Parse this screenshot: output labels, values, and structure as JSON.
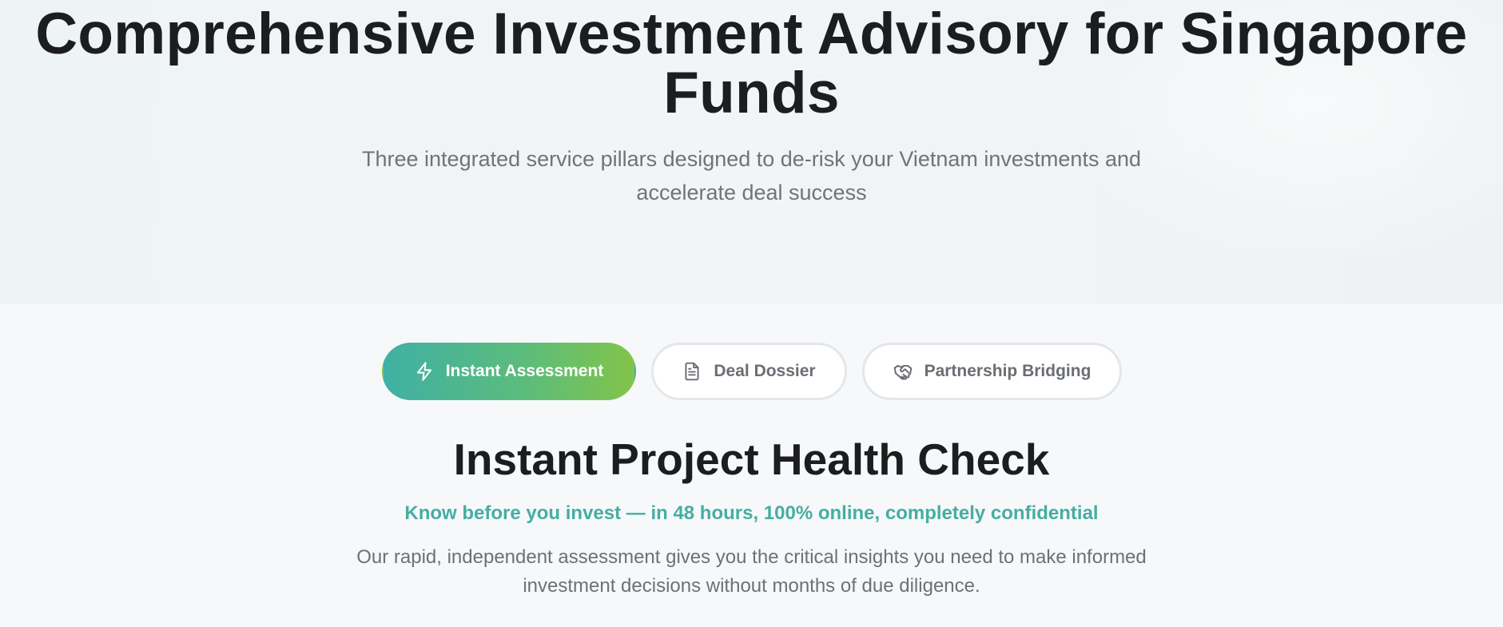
{
  "hero": {
    "title": "Comprehensive Investment Advisory for Singapore Funds",
    "subtitle": "Three integrated service pillars designed to de-risk your Vietnam investments and accelerate deal success"
  },
  "tabs": [
    {
      "label": "Instant Assessment",
      "icon": "lightning-icon",
      "active": true
    },
    {
      "label": "Deal Dossier",
      "icon": "document-icon",
      "active": false
    },
    {
      "label": "Partnership Bridging",
      "icon": "handshake-icon",
      "active": false
    }
  ],
  "section": {
    "title": "Instant Project Health Check",
    "tagline": "Know before you invest — in 48 hours, 100% online, completely confidential",
    "description": "Our rapid, independent assessment gives you the critical insights you need to make informed investment decisions without months of due diligence."
  },
  "colors": {
    "accent_teal": "#45aea2",
    "accent_green": "#82c44a",
    "heading": "#1c1d1f",
    "body_text": "#707378",
    "tab_border": "#e4e7ea"
  }
}
